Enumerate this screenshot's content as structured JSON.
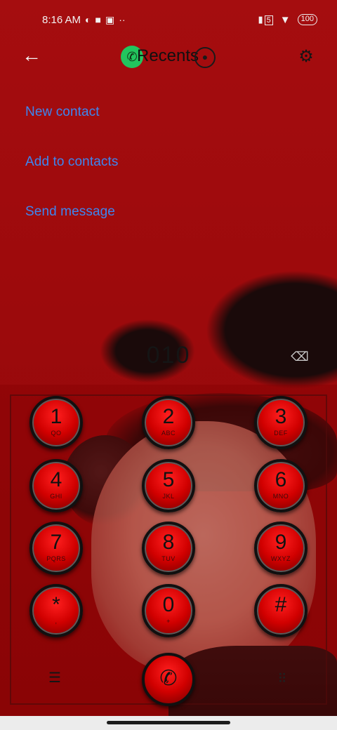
{
  "status_bar": {
    "time": "8:16 AM",
    "icons": [
      "vpn-icon",
      "square-icon",
      "notification-icon",
      "more-dots-icon"
    ],
    "signal_badge": "5",
    "battery": "100"
  },
  "top_bar": {
    "title": "Recents",
    "back_icon": "←",
    "settings_icon": "⚙"
  },
  "actions": [
    {
      "label": "New contact"
    },
    {
      "label": "Add to contacts"
    },
    {
      "label": "Send message"
    }
  ],
  "dialer": {
    "number": "010"
  },
  "keypad": [
    {
      "digit": "1",
      "letters": "QO"
    },
    {
      "digit": "2",
      "letters": "ABC"
    },
    {
      "digit": "3",
      "letters": "DEF"
    },
    {
      "digit": "4",
      "letters": "GHI"
    },
    {
      "digit": "5",
      "letters": "JKL"
    },
    {
      "digit": "6",
      "letters": "MNO"
    },
    {
      "digit": "7",
      "letters": "PQRS"
    },
    {
      "digit": "8",
      "letters": "TUV"
    },
    {
      "digit": "9",
      "letters": "WXYZ"
    },
    {
      "digit": "*",
      "letters": ","
    },
    {
      "digit": "0",
      "letters": "+"
    },
    {
      "digit": "#",
      "letters": ""
    }
  ],
  "colors": {
    "accent_link": "#3d86f0",
    "background": "#a40b0d",
    "call_green": "#22c55e",
    "key_red": "#d10000"
  }
}
